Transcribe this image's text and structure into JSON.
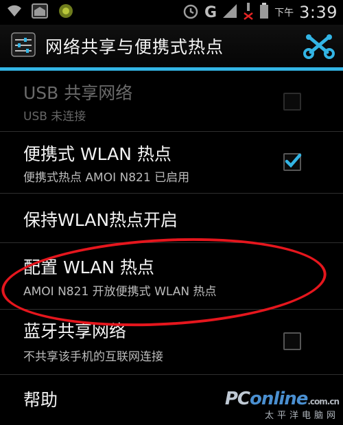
{
  "status_bar": {
    "network": "G",
    "ampm": "下午",
    "time": "3:39",
    "icons": [
      "wifi-icon",
      "sd-card-icon",
      "usb-debug-icon",
      "alarm-icon",
      "signal-icon",
      "no-sim-icon",
      "battery-icon"
    ]
  },
  "action_bar": {
    "title": "网络共享与便携式热点",
    "app_icon": "settings-sliders-icon",
    "right_icon": "tethering-icon"
  },
  "items": [
    {
      "title": "USB 共享网络",
      "subtitle": "USB 未连接",
      "has_checkbox": true,
      "checked": false,
      "enabled": false
    },
    {
      "title": "便携式 WLAN 热点",
      "subtitle": "便携式热点 AMOI N821 已启用",
      "has_checkbox": true,
      "checked": true,
      "enabled": true
    },
    {
      "title": "保持WLAN热点开启",
      "subtitle": "",
      "has_checkbox": false,
      "enabled": true
    },
    {
      "title": "配置 WLAN 热点",
      "subtitle": "AMOI N821 开放便携式 WLAN 热点",
      "has_checkbox": false,
      "enabled": true
    },
    {
      "title": "蓝牙共享网络",
      "subtitle": "不共享该手机的互联网连接",
      "has_checkbox": true,
      "checked": false,
      "enabled": true
    },
    {
      "title": "帮助",
      "subtitle": "",
      "has_checkbox": false,
      "enabled": true
    }
  ],
  "watermark": {
    "brand_prefix": "PC",
    "brand_suffix": "online",
    "brand_domain": ".com.cn",
    "tagline": "太平洋电脑网"
  },
  "colors": {
    "accent": "#33b5e5",
    "annotation": "#e5161d",
    "background": "#000000"
  }
}
